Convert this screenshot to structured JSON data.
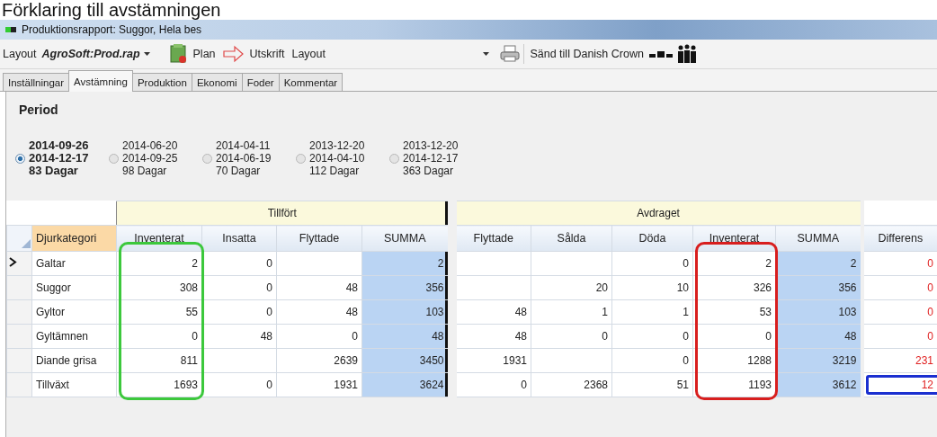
{
  "heading": "Förklaring till avstämningen",
  "window": {
    "title": "Produktionsrapport: Suggor, Hela bes"
  },
  "toolbar": {
    "layout_label": "Layout",
    "layout_value": "AgroSoft:Prod.rap",
    "plan": "Plan",
    "print": "Utskrift",
    "print_layout": "Layout",
    "send": "Sänd till Danish Crown"
  },
  "tabs": [
    {
      "label": "Inställningar",
      "selected": false
    },
    {
      "label": "Avstämning",
      "selected": true
    },
    {
      "label": "Produktion",
      "selected": false
    },
    {
      "label": "Ekonomi",
      "selected": false
    },
    {
      "label": "Foder",
      "selected": false
    },
    {
      "label": "Kommentar",
      "selected": false
    }
  ],
  "period": {
    "title": "Period",
    "options": [
      {
        "from": "2014-09-26",
        "to": "2014-12-17",
        "days": "83 Dagar",
        "selected": true
      },
      {
        "from": "2014-06-20",
        "to": "2014-09-25",
        "days": "98 Dagar",
        "selected": false
      },
      {
        "from": "2014-04-11",
        "to": "2014-06-19",
        "days": "70 Dagar",
        "selected": false
      },
      {
        "from": "2013-12-20",
        "to": "2014-04-10",
        "days": "112 Dagar",
        "selected": false
      },
      {
        "from": "2013-12-20",
        "to": "2014-12-17",
        "days": "363 Dagar",
        "selected": false
      }
    ]
  },
  "grid": {
    "row_header": "Djurkategori",
    "groups": [
      {
        "title": "Tillfört",
        "columns": [
          {
            "label": "Inventerat",
            "kind": "value",
            "color": "#3cc83c"
          },
          {
            "label": "Insatta",
            "kind": "value"
          },
          {
            "label": "Flyttade",
            "kind": "value"
          },
          {
            "label": "SUMMA",
            "kind": "summa"
          }
        ]
      },
      {
        "title": "Avdraget",
        "columns": [
          {
            "label": "Flyttade",
            "kind": "value"
          },
          {
            "label": "Sålda",
            "kind": "value"
          },
          {
            "label": "Döda",
            "kind": "value"
          },
          {
            "label": "Inventerat",
            "kind": "value",
            "color": "#d81e1e"
          },
          {
            "label": "SUMMA",
            "kind": "summa"
          }
        ]
      }
    ],
    "difference": {
      "label": "Differens"
    },
    "rows": [
      {
        "label": "Galtar",
        "current": true,
        "cells": [
          {
            "value": "2"
          },
          {
            "value": "0"
          },
          {},
          {
            "value": "2"
          },
          {},
          {},
          {
            "value": "0"
          },
          {
            "value": "2"
          },
          {
            "value": "2"
          }
        ],
        "difference": "0"
      },
      {
        "label": "Suggor",
        "current": false,
        "cells": [
          {
            "value": "308"
          },
          {
            "value": "0"
          },
          {
            "value": "48"
          },
          {
            "value": "356"
          },
          {},
          {
            "value": "20"
          },
          {
            "value": "10"
          },
          {
            "value": "326"
          },
          {
            "value": "356"
          }
        ],
        "difference": "0"
      },
      {
        "label": "Gyltor",
        "current": false,
        "cells": [
          {
            "value": "55"
          },
          {
            "value": "0"
          },
          {
            "value": "48"
          },
          {
            "value": "103"
          },
          {
            "value": "48"
          },
          {
            "value": "1"
          },
          {
            "value": "1"
          },
          {
            "value": "53"
          },
          {
            "value": "103"
          }
        ],
        "difference": "0"
      },
      {
        "label": "Gyltämnen",
        "current": false,
        "cells": [
          {
            "value": "0"
          },
          {
            "value": "48"
          },
          {
            "value": "0"
          },
          {
            "value": "48"
          },
          {
            "value": "48"
          },
          {
            "value": "0"
          },
          {
            "value": "0"
          },
          {
            "value": "0"
          },
          {
            "value": "48"
          }
        ],
        "difference": "0"
      },
      {
        "label": "Diande grisa",
        "current": false,
        "cells": [
          {
            "value": "811"
          },
          {},
          {
            "value": "2639"
          },
          {
            "value": "3450"
          },
          {
            "value": "1931"
          },
          {},
          {
            "value": "0"
          },
          {
            "value": "1288"
          },
          {
            "value": "3219"
          }
        ],
        "difference": "231"
      },
      {
        "label": "Tillväxt",
        "current": false,
        "cells": [
          {
            "value": "1693"
          },
          {
            "value": "0"
          },
          {
            "value": "1931"
          },
          {
            "value": "3624"
          },
          {
            "value": "0"
          },
          {
            "value": "2368"
          },
          {
            "value": "51"
          },
          {
            "value": "1193"
          },
          {
            "value": "3612"
          }
        ],
        "difference": "12",
        "color": "#1a2fd0"
      }
    ]
  }
}
